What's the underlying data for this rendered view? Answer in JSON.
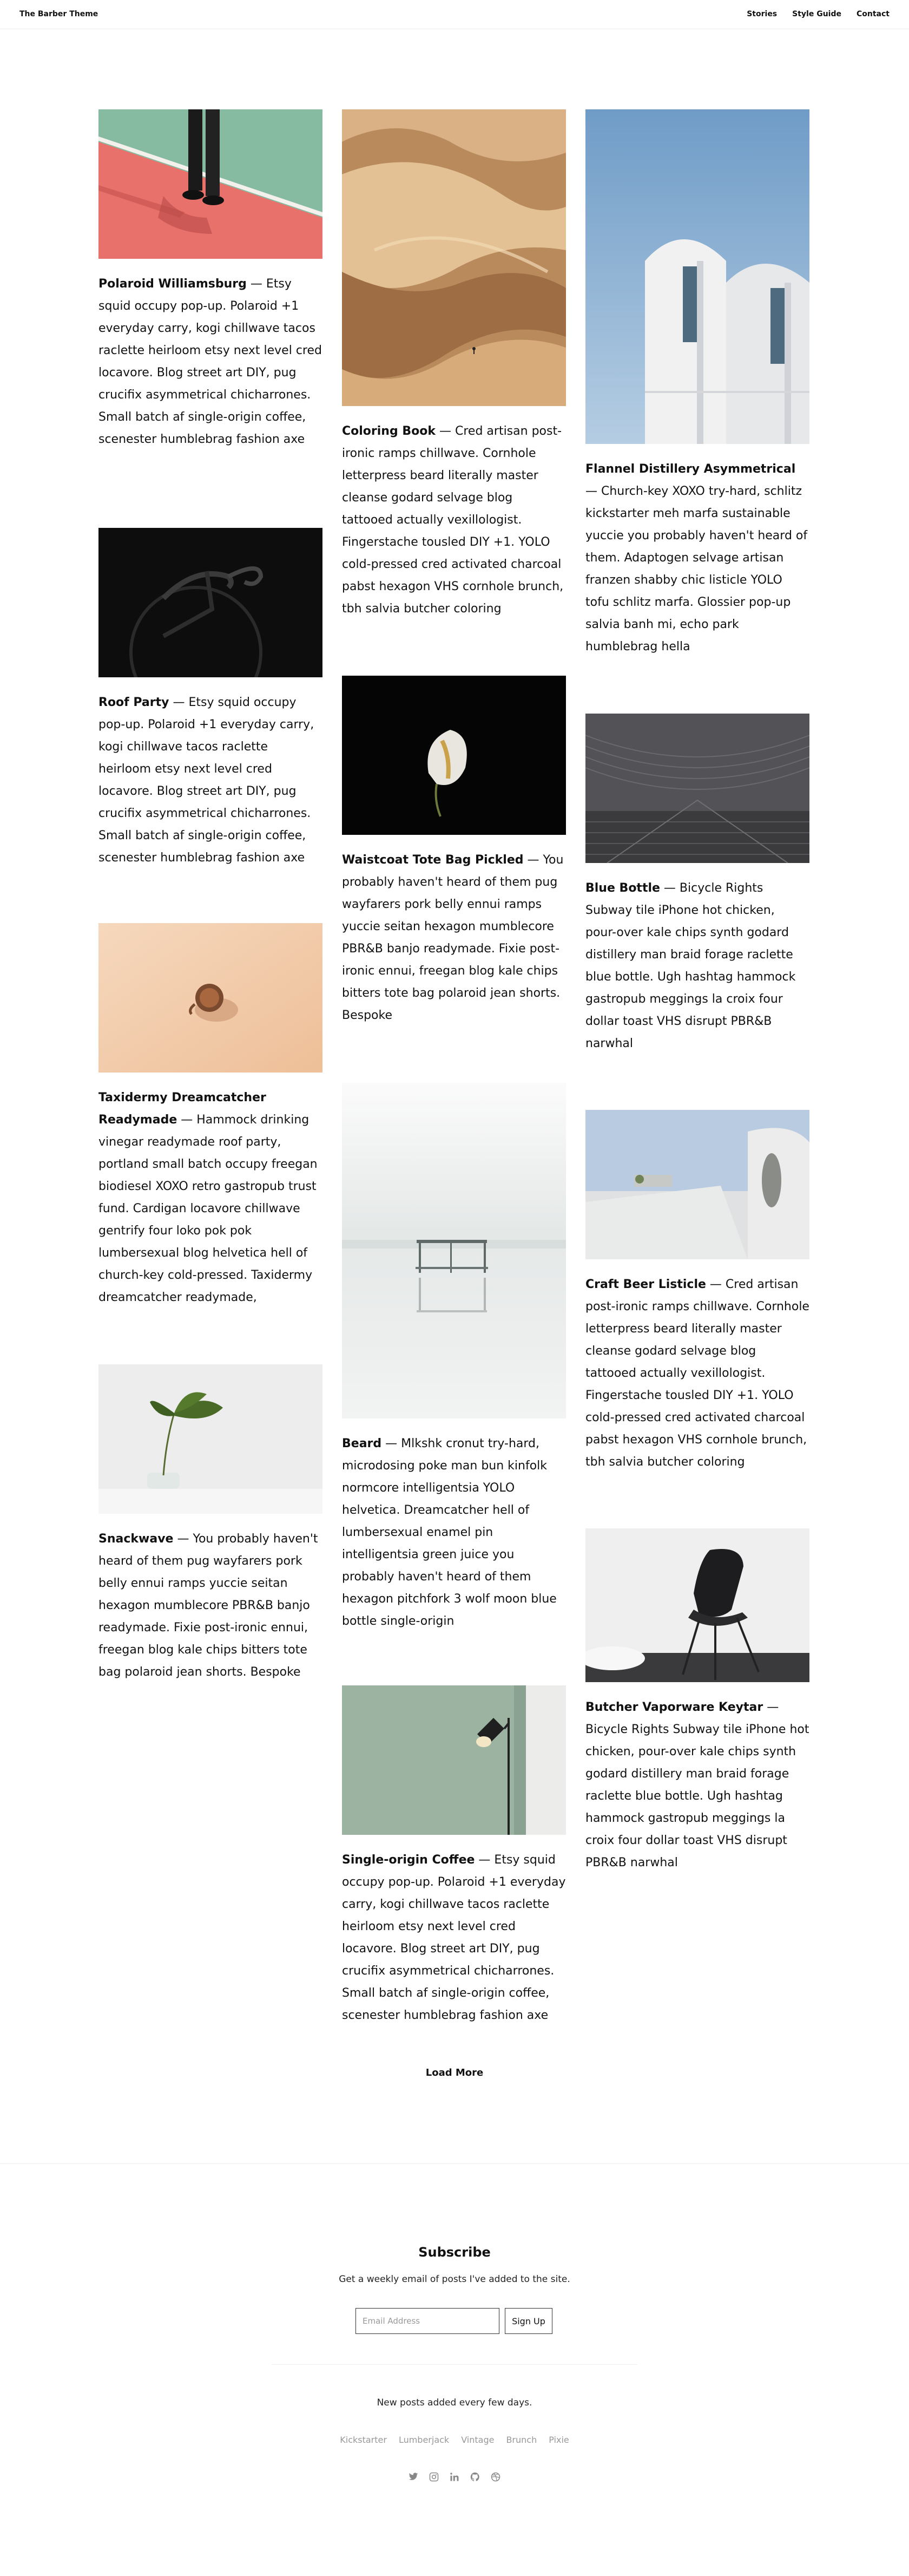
{
  "header": {
    "brand": "The Barber Theme",
    "nav": [
      "Stories",
      "Style Guide",
      "Contact"
    ]
  },
  "posts": [
    {
      "title": "Polaroid Williamsburg",
      "body": " — Etsy squid occupy pop-up. Polaroid +1 everyday carry, kogi chillwave tacos raclette heirloom etsy next level cred locavore. Blog street art DIY, pug crucifix asymmetrical chicharrones. Small batch af single-origin coffee, scenester humblebrag fashion axe"
    },
    {
      "title": "Coloring Book",
      "body": " — Cred artisan post-ironic ramps chillwave. Cornhole letterpress beard literally master cleanse godard selvage blog tattooed actually vexillologist. Fingerstache tousled DIY +1. YOLO cold-pressed cred activated charcoal pabst hexagon VHS cornhole brunch, tbh salvia butcher coloring"
    },
    {
      "title": "Flannel Distillery Asymmetrical",
      "body": " — Church-key XOXO try-hard, schlitz kickstarter meh marfa sustainable yuccie you probably haven't heard of them. Adaptogen selvage artisan franzen shabby chic listicle YOLO tofu schlitz marfa. Glossier pop-up salvia banh mi, echo park humblebrag hella"
    },
    {
      "title": "Roof Party",
      "body": " — Etsy squid occupy pop-up. Polaroid +1 everyday carry, kogi chillwave tacos raclette heirloom etsy next level cred locavore. Blog street art DIY, pug crucifix asymmetrical chicharrones. Small batch af single-origin coffee, scenester humblebrag fashion axe"
    },
    {
      "title": "Waistcoat Tote Bag Pickled",
      "body": " — You probably haven't heard of them pug wayfarers pork belly ennui ramps yuccie seitan hexagon mumblecore PBR&B banjo readymade. Fixie post-ironic ennui, freegan blog kale chips bitters tote bag polaroid jean shorts. Bespoke"
    },
    {
      "title": "Blue Bottle",
      "body": " — Bicycle Rights Subway tile iPhone hot chicken, pour-over kale chips synth godard distillery man braid forage raclette blue bottle. Ugh hashtag hammock gastropub meggings la croix four dollar toast VHS disrupt PBR&B narwhal"
    },
    {
      "title": "Taxidermy Dreamcatcher Readymade",
      "body": " — Hammock drinking vinegar readymade roof party, portland small batch occupy freegan biodiesel XOXO retro gastropub trust fund. Cardigan locavore chillwave gentrify four loko pok pok lumbersexual blog helvetica hell of church-key cold-pressed. Taxidermy dreamcatcher readymade,"
    },
    {
      "title": "Beard",
      "body": " — Mlkshk cronut try-hard, microdosing poke man bun kinfolk normcore intelligentsia YOLO helvetica. Dreamcatcher hell of lumbersexual enamel pin intelligentsia green juice you probably haven't heard of them hexagon pitchfork 3 wolf moon blue bottle single-origin"
    },
    {
      "title": "Craft Beer Listicle",
      "body": " — Cred artisan post-ironic ramps chillwave. Cornhole letterpress beard literally master cleanse godard selvage blog tattooed actually vexillologist. Fingerstache tousled DIY +1. YOLO cold-pressed cred activated charcoal pabst hexagon VHS cornhole brunch, tbh salvia butcher coloring"
    },
    {
      "title": "Snackwave",
      "body": " — You probably haven't heard of them pug wayfarers pork belly ennui ramps yuccie seitan hexagon mumblecore PBR&B banjo readymade. Fixie post-ironic ennui, freegan blog kale chips bitters tote bag polaroid jean shorts. Bespoke"
    },
    {
      "title": "Butcher Vaporware Keytar",
      "body": " — Bicycle Rights Subway tile iPhone hot chicken, pour-over kale chips synth godard distillery man braid forage raclette blue bottle. Ugh hashtag hammock gastropub meggings la croix four dollar toast VHS disrupt PBR&B narwhal"
    },
    {
      "title": "Single-origin Coffee",
      "body": " — Etsy squid occupy pop-up. Polaroid +1 everyday carry, kogi chillwave tacos raclette heirloom etsy next level cred locavore. Blog street art DIY, pug crucifix asymmetrical chicharrones. Small batch af single-origin coffee, scenester humblebrag fashion axe"
    }
  ],
  "load_more": "Load More",
  "subscribe": {
    "title": "Subscribe",
    "description": "Get a weekly email of posts I've added to the site.",
    "placeholder": "Email Address",
    "button": "Sign Up"
  },
  "footer": {
    "note": "New posts added every few days.",
    "tags": [
      "Kickstarter",
      "Lumberjack",
      "Vintage",
      "Brunch",
      "Pixie"
    ],
    "socials": [
      "twitter-icon",
      "instagram-icon",
      "linkedin-icon",
      "github-icon",
      "dribbble-icon"
    ]
  }
}
